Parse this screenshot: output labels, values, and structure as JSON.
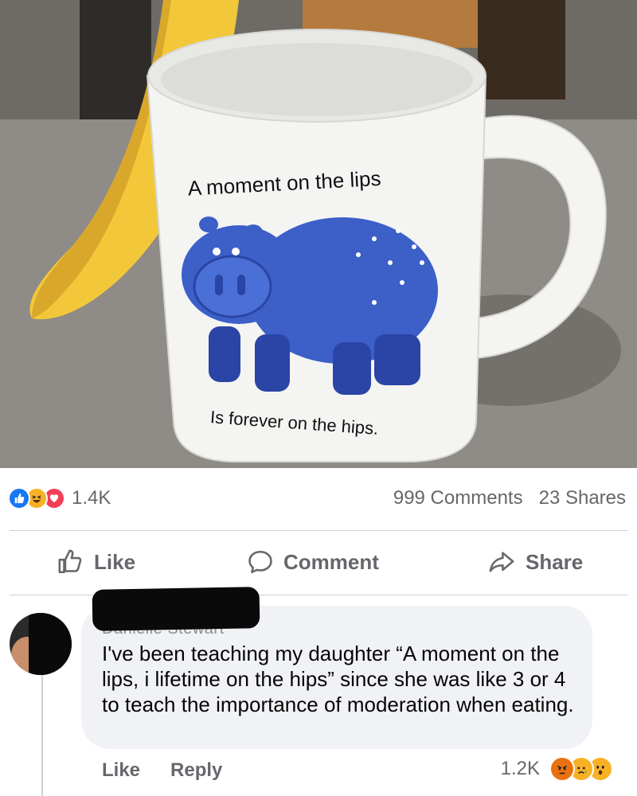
{
  "photo": {
    "mug_text_top": "A moment on the lips",
    "mug_text_bottom": "Is forever on the hips.",
    "colors": {
      "hippo": "#3c5fc8",
      "hippo_dark": "#2a45a5",
      "banana": "#f2c83a",
      "counter": "#8f8b86",
      "mug": "#f4f4f2"
    }
  },
  "post": {
    "reactions": [
      "like-icon",
      "haha-icon",
      "love-icon"
    ],
    "reaction_count": "1.4K",
    "comments_count": "999 Comments",
    "shares_count": "23 Shares"
  },
  "actions": {
    "like": "Like",
    "comment": "Comment",
    "share": "Share"
  },
  "comment": {
    "author": "Danielle Stewart",
    "text": "I've been teaching my daughter “A moment on the lips, i lifetime on the hips” since she was like 3 or 4 to teach the importance of moderation when eating.",
    "like_label": "Like",
    "reply_label": "Reply",
    "reaction_count": "1.2K",
    "reactions": [
      "angry-icon",
      "sad-icon",
      "wow-icon"
    ]
  }
}
